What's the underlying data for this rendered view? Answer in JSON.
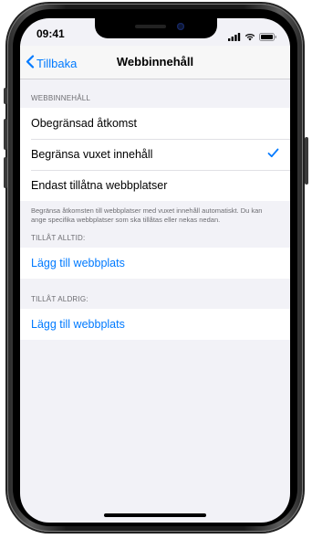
{
  "status": {
    "time": "09:41",
    "icons": [
      "signal-icon",
      "wifi-icon",
      "battery-icon"
    ]
  },
  "nav": {
    "back_label": "Tillbaka",
    "title": "Webbinnehåll"
  },
  "section1": {
    "header": "WEBBINNEHÅLL",
    "options": [
      {
        "label": "Obegränsad åtkomst",
        "selected": false
      },
      {
        "label": "Begränsa vuxet innehåll",
        "selected": true
      },
      {
        "label": "Endast tillåtna webbplatser",
        "selected": false
      }
    ],
    "footer": "Begränsa åtkomsten till webbplatser med vuxet innehåll automatiskt. Du kan ange specifika webbplatser som ska tillåtas eller nekas nedan."
  },
  "section2": {
    "header": "TILLÅT ALLTID:",
    "add_label": "Lägg till webbplats"
  },
  "section3": {
    "header": "TILLÅT ALDRIG:",
    "add_label": "Lägg till webbplats"
  },
  "colors": {
    "accent": "#007aff",
    "background": "#f2f2f7",
    "header_text": "#6d6d72"
  }
}
